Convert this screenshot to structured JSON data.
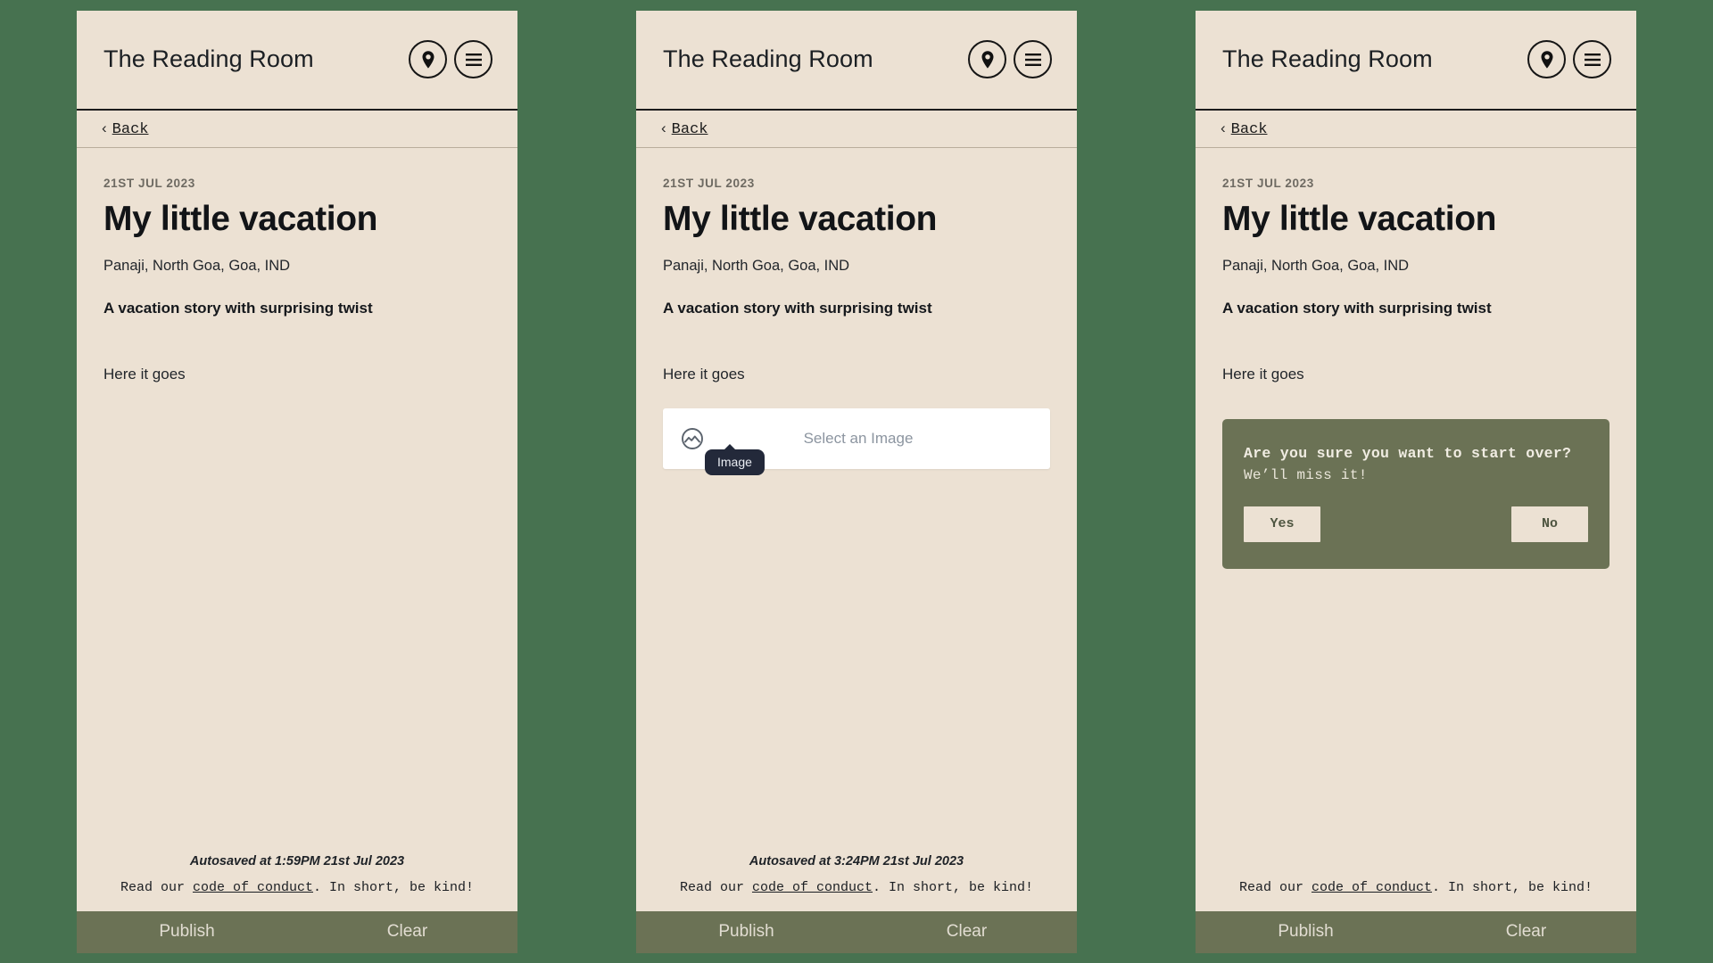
{
  "theme": {
    "page_background": "#477250",
    "panel_background": "#ece1d3",
    "action_bar": "#6b7255",
    "dialog_background": "#6b7255",
    "tooltip_background": "#23293a",
    "picker_background": "#ffffff"
  },
  "header": {
    "title": "The Reading Room",
    "location_icon": "location-pin-icon",
    "menu_icon": "hamburger-menu-icon"
  },
  "back": {
    "chevron": "‹",
    "label": "Back"
  },
  "post": {
    "date": "21ST JUL 2023",
    "title": "My little vacation",
    "location": "Panaji, North Goa, Goa, IND",
    "subtitle": "A vacation story with surprising twist",
    "body": "Here it goes"
  },
  "image_picker": {
    "icon": "image-placeholder-icon",
    "label": "Select an Image",
    "tooltip": "Image"
  },
  "confirm_dialog": {
    "title": "Are you sure you want to start over?",
    "subtitle": "We’ll miss it!",
    "yes_label": "Yes",
    "no_label": "No"
  },
  "footer": {
    "conduct_prefix": "Read our ",
    "conduct_link": "code of conduct",
    "conduct_suffix": ". In short, be kind!",
    "publish_label": "Publish",
    "clear_label": "Clear"
  },
  "panels": [
    {
      "name": "editor-default",
      "autosave": "Autosaved at 1:59PM 21st Jul 2023",
      "show_image_picker": false,
      "show_confirm_dialog": false
    },
    {
      "name": "editor-image-picker",
      "autosave": "Autosaved at 3:24PM 21st Jul 2023",
      "show_image_picker": true,
      "show_confirm_dialog": false
    },
    {
      "name": "editor-confirm-clear",
      "autosave": "",
      "show_image_picker": false,
      "show_confirm_dialog": true
    }
  ]
}
